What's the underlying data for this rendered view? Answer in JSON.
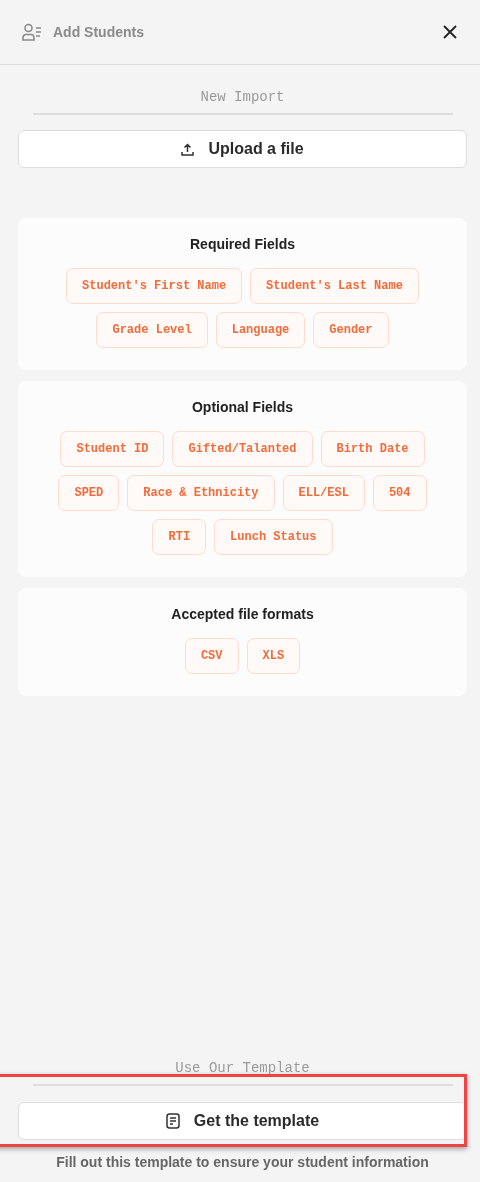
{
  "header": {
    "title": "Add Students"
  },
  "import": {
    "heading": "New Import",
    "button": "Upload a file"
  },
  "cards": [
    {
      "title": "Required Fields",
      "chips": [
        "Student's First Name",
        "Student's Last Name",
        "Grade Level",
        "Language",
        "Gender"
      ]
    },
    {
      "title": "Optional Fields",
      "chips": [
        "Student ID",
        "Gifted/Talanted",
        "Birth Date",
        "SPED",
        "Race & Ethnicity",
        "ELL/ESL",
        "504",
        "RTI",
        "Lunch Status"
      ]
    },
    {
      "title": "Accepted file formats",
      "chips": [
        "CSV",
        "XLS"
      ]
    }
  ],
  "template": {
    "heading": "Use Our Template",
    "button": "Get the template",
    "highlighted": true,
    "note": "Fill out this template to ensure your student information"
  }
}
